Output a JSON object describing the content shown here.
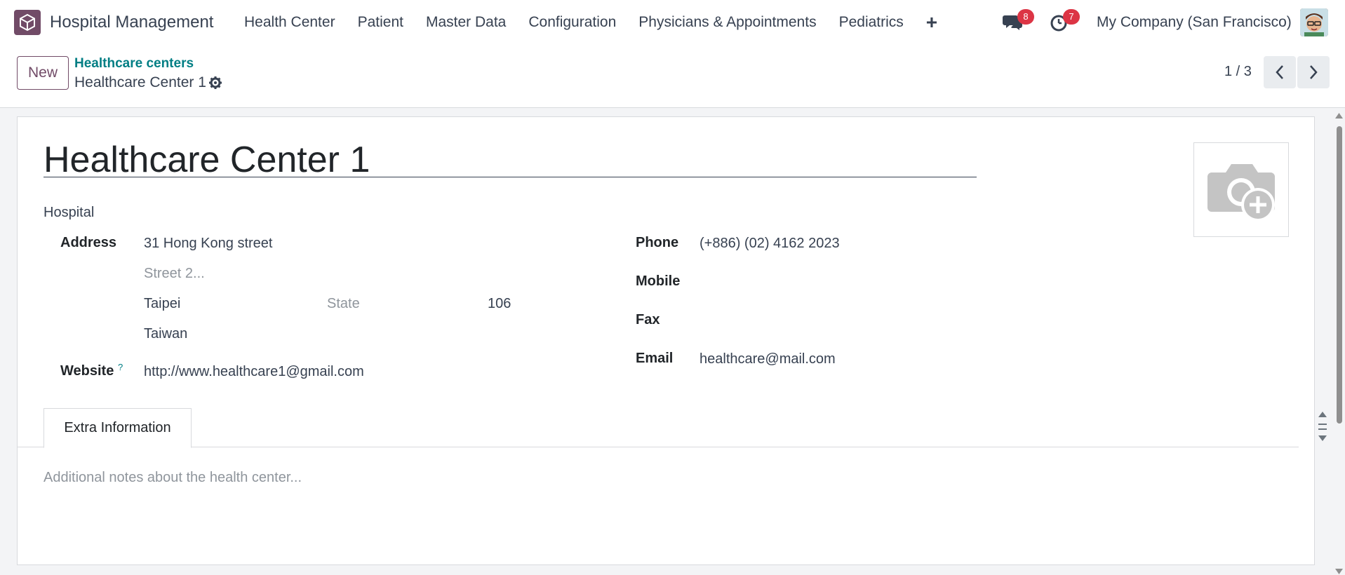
{
  "navbar": {
    "app_title": "Hospital Management",
    "menu": [
      "Health Center",
      "Patient",
      "Master Data",
      "Configuration",
      "Physicians & Appointments",
      "Pediatrics"
    ],
    "messages_count": "8",
    "activities_count": "7",
    "company": "My Company (San Francisco)"
  },
  "control": {
    "new_label": "New",
    "breadcrumb_parent": "Healthcare centers",
    "breadcrumb_current": "Healthcare Center 1",
    "pager": "1 / 3"
  },
  "form": {
    "name": "Healthcare Center 1",
    "type": "Hospital",
    "address_label": "Address",
    "street": "31 Hong Kong street",
    "street2_placeholder": "Street 2...",
    "city": "Taipei",
    "state_placeholder": "State",
    "zip": "106",
    "country": "Taiwan",
    "website_label": "Website",
    "website_help": "?",
    "website": "http://www.healthcare1@gmail.com",
    "phone_label": "Phone",
    "phone": "(+886) (02) 4162 2023",
    "mobile_label": "Mobile",
    "fax_label": "Fax",
    "email_label": "Email",
    "email": "healthcare@mail.com"
  },
  "tabs": {
    "extra_info": "Extra Information",
    "notes_placeholder": "Additional notes about the health center..."
  },
  "colors": {
    "brand": "#714b67",
    "link": "#017e84",
    "badge": "#dc3545"
  }
}
